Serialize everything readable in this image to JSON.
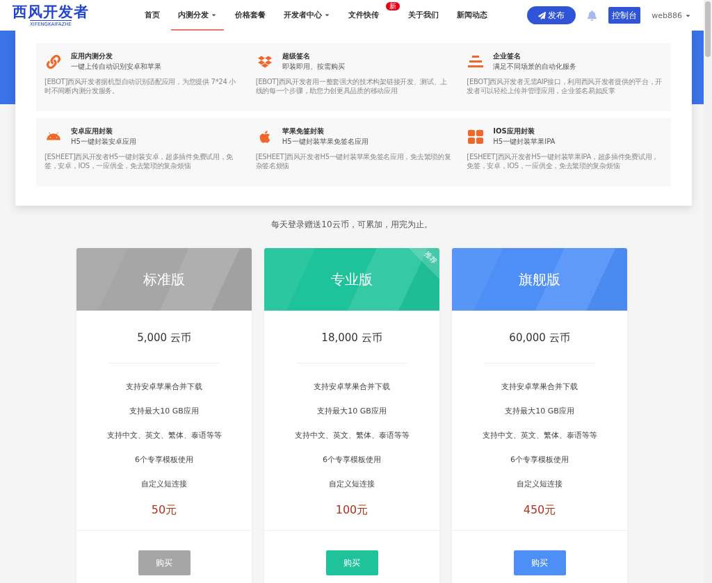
{
  "header": {
    "logo": {
      "title": "西风开发者",
      "subtitle": "XIFENGKAIFAZHE"
    },
    "nav": [
      {
        "label": "首页",
        "selected": false,
        "dropdown": false
      },
      {
        "label": "内测分发",
        "selected": true,
        "dropdown": true
      },
      {
        "label": "价格套餐",
        "selected": false,
        "dropdown": false
      },
      {
        "label": "开发者中心",
        "selected": false,
        "dropdown": true
      },
      {
        "label": "文件快传",
        "selected": false,
        "dropdown": false,
        "badge": "新"
      },
      {
        "label": "关于我们",
        "selected": false,
        "dropdown": false
      },
      {
        "label": "新闻动态",
        "selected": false,
        "dropdown": false
      }
    ],
    "publish_button": "发布",
    "console_button": "控制台",
    "user": "web886"
  },
  "menu": {
    "items": [
      {
        "title": "应用内测分发",
        "subtitle": "一键上传自动识别安卓和苹果",
        "description": "[EBOT]西风开发者据机型自动识别适配应用，为您提供 7*24 小时不间断内测分发服务。"
      },
      {
        "title": "超级签名",
        "subtitle": "即装即用、按需购买",
        "description": "[EBOT]西风开发者用一整套强大的技术构架链接开发、测试、上线的每一个步骤，助您力创更具品质的移动应用"
      },
      {
        "title": "企业签名",
        "subtitle": "满足不同场景的自动化服务",
        "description": "[EBOT]西风开发者无需AIP接口，利用西风开发者提供的平台，开发者可以轻松上传并管理应用，企业签名易如反掌"
      },
      {
        "title": "安卓应用封装",
        "subtitle": "H5一键封装安卓应用",
        "description": "[ESHEET]西风开发者H5一键封装安卓，超多插件免费试用，免签，安卓，IOS，一应俱全，免去繁琐的复杂烦恼"
      },
      {
        "title": "苹果免签封装",
        "subtitle": "H5一键封装苹果免签名应用",
        "description": "[ESHEET]西风开发者H5一键封装苹果免签名应用，免去繁琐的复杂签名烦恼"
      },
      {
        "title": "IOS应用封装",
        "subtitle": "H5一键封装苹果IPA",
        "description": "[ESHEET]西风开发者H5一键封装苹果IPA，超多插件免费试用，免签，安卓，IOS，一应俱全，免去繁琐的复杂烦恼"
      }
    ]
  },
  "pricing": {
    "subtitle": "每天登录赠送10云币，可累加，用完为止。",
    "plans": [
      {
        "name": "标准版",
        "color": "#a6a6a6",
        "coins": "5,000 云币",
        "features": [
          "支持安卓苹果合并下载",
          "支持最大10 GB应用",
          "支持中文、英文、繁体、泰语等等",
          "6个专享模板使用",
          "自定义短连接"
        ],
        "price": "50元",
        "button": "购买"
      },
      {
        "name": "专业版",
        "color": "#1fc39b",
        "ribbon": "推荐",
        "coins": "18,000 云币",
        "features": [
          "支持安卓苹果合并下载",
          "支持最大10 GB应用",
          "支持中文、英文、繁体、泰语等等",
          "6个专享模板使用",
          "自定义短连接"
        ],
        "price": "100元",
        "button": "购买"
      },
      {
        "name": "旗舰版",
        "color": "#4d8ff7",
        "coins": "60,000 云币",
        "features": [
          "支持安卓苹果合并下载",
          "支持最大10 GB应用",
          "支持中文、英文、繁体、泰语等等",
          "6个专享模板使用",
          "自定义短连接"
        ],
        "price": "450元",
        "button": "购买"
      }
    ]
  }
}
